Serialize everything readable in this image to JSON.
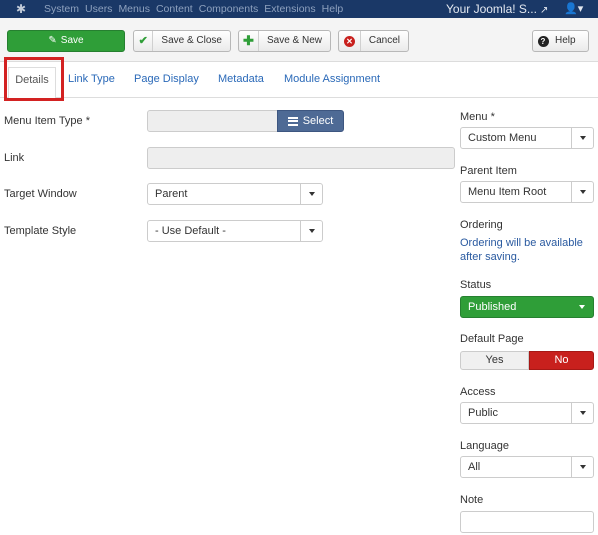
{
  "topbar": {
    "menu": [
      "System",
      "Users",
      "Menus",
      "Content",
      "Components",
      "Extensions",
      "Help"
    ],
    "site_name": "Your Joomla! S...",
    "user_icon": "user-icon"
  },
  "toolbar": {
    "save": "Save",
    "save_close": "Save & Close",
    "save_new": "Save & New",
    "cancel": "Cancel",
    "help": "Help"
  },
  "tabs": [
    "Details",
    "Link Type",
    "Page Display",
    "Metadata",
    "Module Assignment"
  ],
  "form": {
    "menu_item_type": {
      "label": "Menu Item Type *",
      "value": "",
      "button": "Select"
    },
    "link": {
      "label": "Link",
      "value": ""
    },
    "target_window": {
      "label": "Target Window",
      "value": "Parent"
    },
    "template_style": {
      "label": "Template Style",
      "value": "- Use Default -"
    }
  },
  "sidebar": {
    "menu": {
      "label": "Menu *",
      "value": "Custom Menu"
    },
    "parent_item": {
      "label": "Parent Item",
      "value": "Menu Item Root"
    },
    "ordering": {
      "label": "Ordering",
      "text": "Ordering will be available after saving."
    },
    "status": {
      "label": "Status",
      "value": "Published"
    },
    "default_page": {
      "label": "Default Page",
      "yes": "Yes",
      "no": "No"
    },
    "access": {
      "label": "Access",
      "value": "Public"
    },
    "language": {
      "label": "Language",
      "value": "All"
    },
    "note": {
      "label": "Note",
      "value": ""
    }
  },
  "colors": {
    "navbar": "#1a3867",
    "save_green": "#2f9e38",
    "danger_red": "#c8201d",
    "select_blue": "#4e6a95",
    "link_blue": "#2a69b8"
  }
}
